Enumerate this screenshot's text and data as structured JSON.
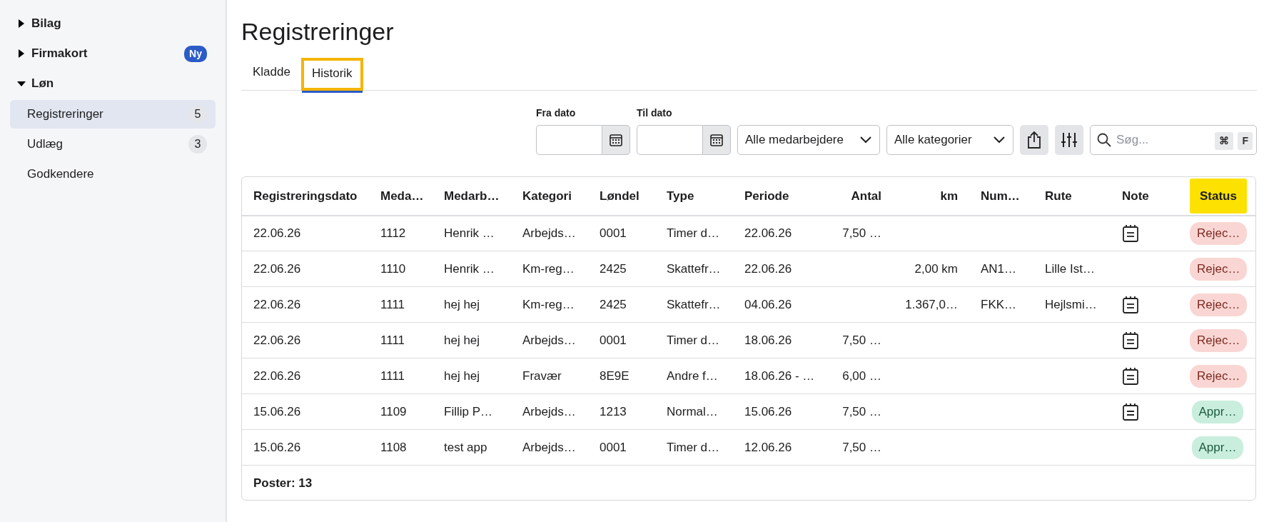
{
  "sidebar": {
    "groups": [
      {
        "label": "Bilag",
        "expanded": false
      },
      {
        "label": "Firmakort",
        "expanded": false,
        "badge": "Ny"
      },
      {
        "label": "Løn",
        "expanded": true,
        "items": [
          {
            "label": "Registreringer",
            "count": "5",
            "selected": true
          },
          {
            "label": "Udlæg",
            "count": "3",
            "selected": false
          },
          {
            "label": "Godkendere",
            "selected": false
          }
        ]
      }
    ]
  },
  "page": {
    "title": "Registreringer"
  },
  "tabs": [
    {
      "label": "Kladde",
      "selected": false,
      "highlighted": false
    },
    {
      "label": "Historik",
      "selected": true,
      "highlighted": true
    }
  ],
  "filters": {
    "from_date": {
      "label": "Fra dato"
    },
    "to_date": {
      "label": "Til dato"
    },
    "employee_select": {
      "value": "Alle medarbejdere"
    },
    "category_select": {
      "value": "Alle kategorier"
    },
    "search": {
      "placeholder": "Søg...",
      "shortcut": [
        "⌘",
        "F"
      ]
    }
  },
  "table": {
    "columns": [
      {
        "label": "Registreringsdato",
        "highlighted": false
      },
      {
        "label": "Meda…",
        "highlighted": false
      },
      {
        "label": "Medarb…",
        "highlighted": false
      },
      {
        "label": "Kategori",
        "highlighted": false
      },
      {
        "label": "Løndel",
        "highlighted": false
      },
      {
        "label": "Type",
        "highlighted": false
      },
      {
        "label": "Periode",
        "highlighted": false
      },
      {
        "label": "Antal",
        "highlighted": false
      },
      {
        "label": "km",
        "highlighted": false
      },
      {
        "label": "Num…",
        "highlighted": false
      },
      {
        "label": "Rute",
        "highlighted": false
      },
      {
        "label": "Note",
        "highlighted": false
      },
      {
        "label": "Status",
        "highlighted": true
      }
    ],
    "rows": [
      {
        "cells": [
          "22.06.26",
          "1112",
          "Henrik …",
          "Arbejds…",
          "0001",
          "Timer d…",
          "22.06.26",
          "7,50 …",
          "",
          "",
          "",
          ""
        ],
        "has_note": true,
        "status": {
          "label": "Rejec…",
          "kind": "rejected"
        }
      },
      {
        "cells": [
          "22.06.26",
          "1110",
          "Henrik …",
          "Km-reg…",
          "2425",
          "Skattefr…",
          "22.06.26",
          "",
          "2,00 km",
          "AN1…",
          "Lille Ist…"
        ],
        "has_note": false,
        "status": {
          "label": "Rejec…",
          "kind": "rejected"
        }
      },
      {
        "cells": [
          "22.06.26",
          "1111",
          "hej hej",
          "Km-reg…",
          "2425",
          "Skattefr…",
          "04.06.26",
          "",
          "1.367,0…",
          "FKK…",
          "Hejlsmi…"
        ],
        "has_note": true,
        "status": {
          "label": "Rejec…",
          "kind": "rejected"
        }
      },
      {
        "cells": [
          "22.06.26",
          "1111",
          "hej hej",
          "Arbejds…",
          "0001",
          "Timer d…",
          "18.06.26",
          "7,50 …",
          "",
          "",
          ""
        ],
        "has_note": true,
        "status": {
          "label": "Rejec…",
          "kind": "rejected"
        }
      },
      {
        "cells": [
          "22.06.26",
          "1111",
          "hej hej",
          "Fravær",
          "8E9E",
          "Andre f…",
          "18.06.26 - …",
          "6,00 …",
          "",
          "",
          ""
        ],
        "has_note": true,
        "status": {
          "label": "Rejec…",
          "kind": "rejected"
        }
      },
      {
        "cells": [
          "15.06.26",
          "1109",
          "Fillip P…",
          "Arbejds…",
          "1213",
          "Normal…",
          "15.06.26",
          "7,50 …",
          "",
          "",
          ""
        ],
        "has_note": true,
        "status": {
          "label": "Appr…",
          "kind": "approved"
        }
      },
      {
        "cells": [
          "15.06.26",
          "1108",
          "test app",
          "Arbejds…",
          "0001",
          "Timer d…",
          "12.06.26",
          "7,50 …",
          "",
          "",
          ""
        ],
        "has_note": false,
        "status": {
          "label": "Appr…",
          "kind": "approved"
        }
      }
    ],
    "footer": "Poster: 13"
  }
}
